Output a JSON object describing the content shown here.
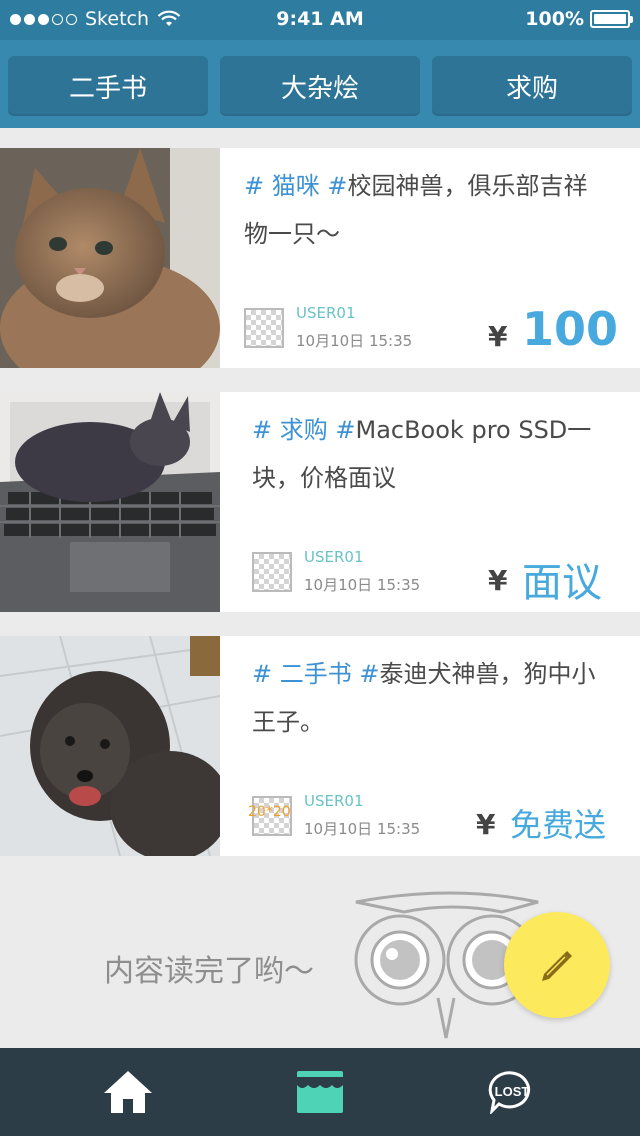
{
  "status": {
    "carrier": "Sketch",
    "time": "9:41 AM",
    "battery": "100%"
  },
  "tabs": [
    {
      "label": "二手书"
    },
    {
      "label": "大杂烩"
    },
    {
      "label": "求购"
    }
  ],
  "posts": [
    {
      "tag": "# 猫咪 #",
      "text": "校园神兽，俱乐部吉祥物一只～",
      "user": "USER01",
      "date": "10月10日 15:35",
      "currency": "¥",
      "price": "100"
    },
    {
      "tag": "# 求购 #",
      "text": "MacBook pro SSD一块，价格面议",
      "user": "USER01",
      "date": "10月10日 15:35",
      "currency": "¥",
      "price": "面议"
    },
    {
      "tag": "# 二手书 #",
      "text": "泰迪犬神兽，狗中小王子。",
      "user": "USER01",
      "date": "10月10日 15:35",
      "currency": "¥",
      "price": "免费送",
      "avatar_overlay": "20*20"
    }
  ],
  "end_message": "内容读完了哟～",
  "bottom_nav": [
    {
      "icon": "home-icon"
    },
    {
      "icon": "store-icon"
    },
    {
      "icon": "lost-icon",
      "label": "LOST"
    }
  ],
  "colors": {
    "accent": "#47a9de",
    "topbar": "#3789b0",
    "tab": "#2e7497",
    "fab": "#fde95c",
    "bottom": "#2d3d47",
    "store_active": "#4fd3b6"
  }
}
